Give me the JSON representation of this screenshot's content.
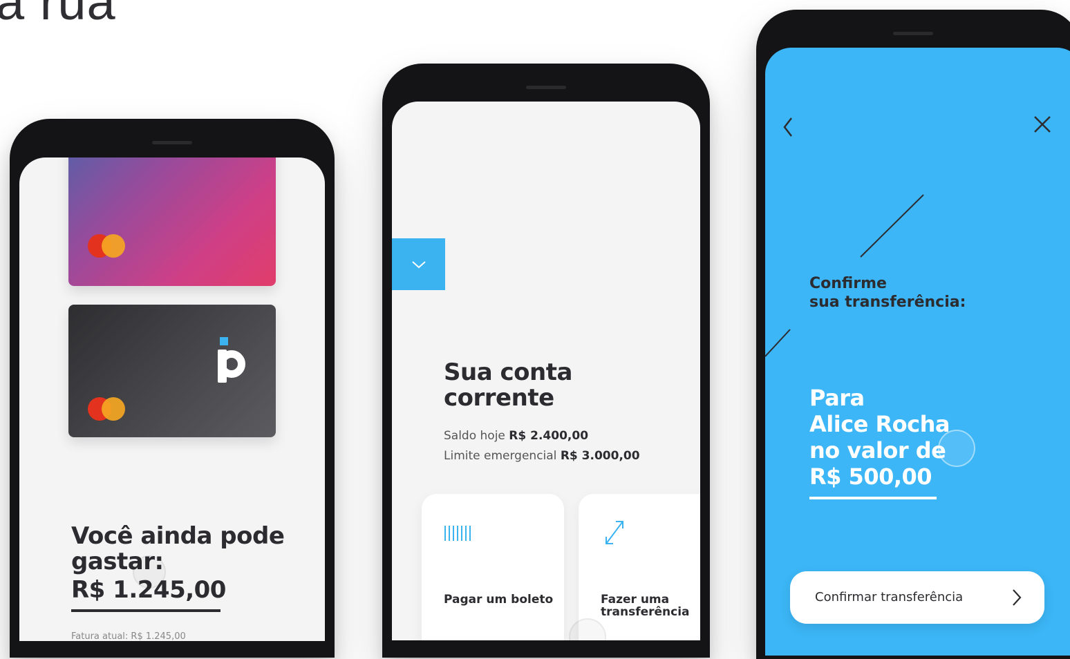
{
  "page": {
    "heading": "a rua"
  },
  "screen_card": {
    "spend_title": "Você ainda pode gastar:",
    "spend_amount": "R$ 1.245,00",
    "footer_text": "Fatura atual: R$ 1.245,00"
  },
  "screen_account": {
    "title": "Sua conta corrente",
    "balance_label": "Saldo hoje",
    "balance_value": "R$ 2.400,00",
    "limit_label": "Limite emergencial",
    "limit_value": "R$ 3.000,00",
    "actions": [
      {
        "label": "Pagar um boleto",
        "icon": "barcode-icon"
      },
      {
        "label": "Fazer uma transferência",
        "icon": "transfer-arrows-icon"
      }
    ]
  },
  "screen_transfer": {
    "confirm_title_line1": "Confirme",
    "confirm_title_line2": "sua transferência:",
    "line1": "Para",
    "line2": "Alice Rocha",
    "line3": "no valor de",
    "line4": "R$ 500,00",
    "confirm_button": "Confirmar transferência"
  },
  "colors": {
    "accent_blue": "#3ab3f0",
    "transfer_background": "#3cb6f6",
    "dark_text": "#2c2c30"
  }
}
